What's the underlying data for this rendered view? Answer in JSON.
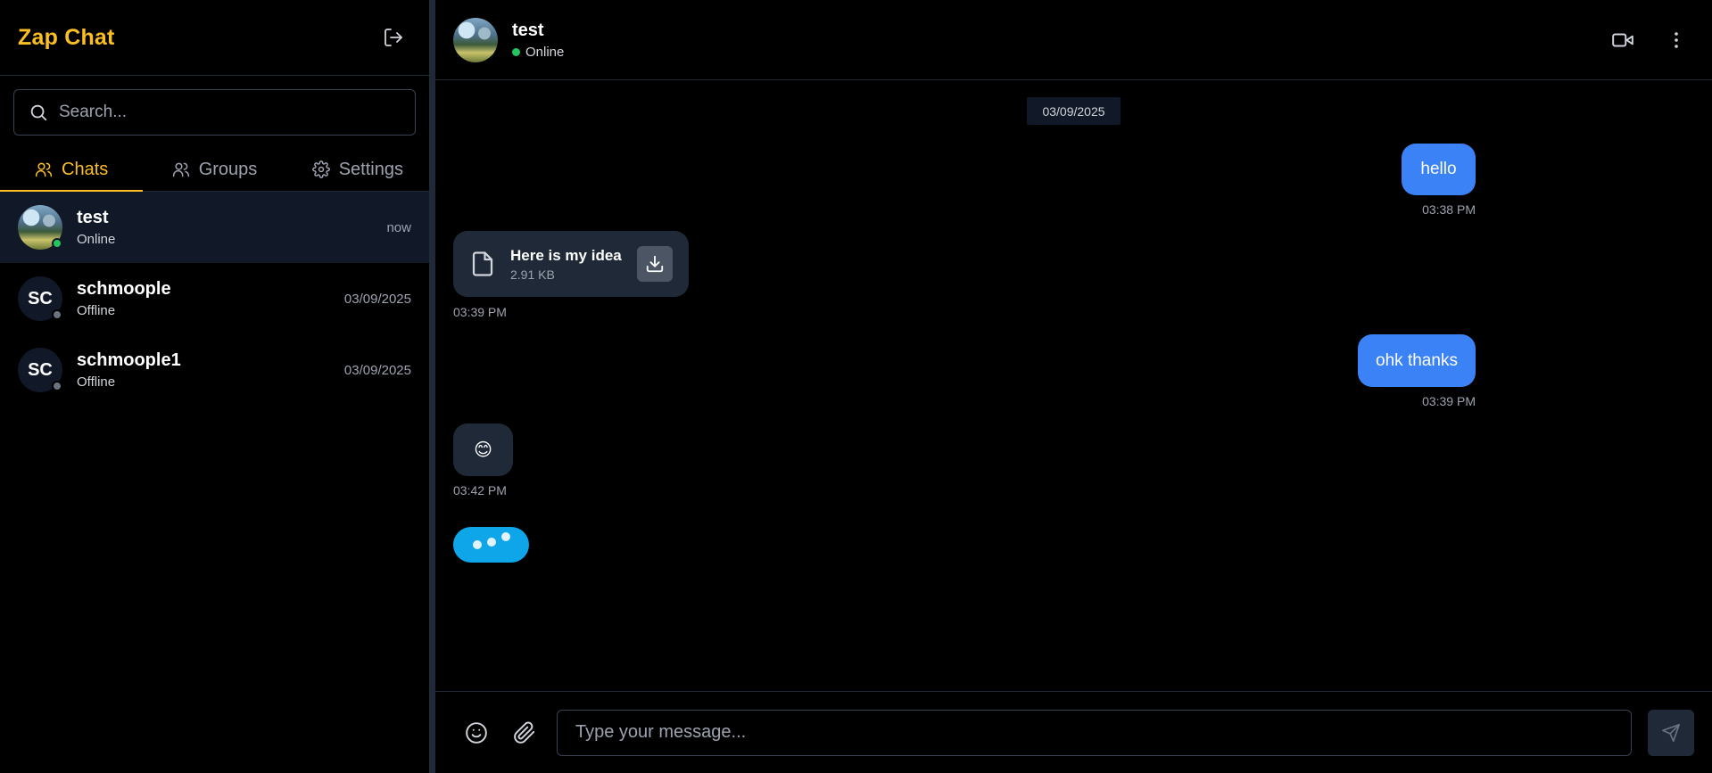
{
  "app": {
    "title": "Zap Chat"
  },
  "colors": {
    "brand": "#fbbf24",
    "outgoing_bubble": "#3b82f6",
    "incoming_bubble": "#1f2937",
    "typing_bubble": "#0ea5e9",
    "online": "#22c55e",
    "offline": "#6b7280"
  },
  "sidebar": {
    "logout_icon": "logout-icon",
    "search": {
      "placeholder": "Search...",
      "value": ""
    },
    "tabs": [
      {
        "label": "Chats",
        "icon": "users-icon",
        "active": true
      },
      {
        "label": "Groups",
        "icon": "users-icon",
        "active": false
      },
      {
        "label": "Settings",
        "icon": "gear-icon",
        "active": false
      }
    ],
    "chats": [
      {
        "name": "test",
        "status": "Online",
        "time": "now",
        "initials": "",
        "selected": true
      },
      {
        "name": "schmoople",
        "status": "Offline",
        "time": "03/09/2025",
        "initials": "SC",
        "selected": false
      },
      {
        "name": "schmoople1",
        "status": "Offline",
        "time": "03/09/2025",
        "initials": "SC",
        "selected": false
      }
    ]
  },
  "conversation": {
    "contact_name": "test",
    "contact_status": "Online",
    "header_icons": [
      "video-icon",
      "more-vertical-icon"
    ],
    "date_divider": "03/09/2025",
    "messages": [
      {
        "direction": "out",
        "type": "text",
        "text": "hello",
        "time": "03:38 PM"
      },
      {
        "direction": "in",
        "type": "file",
        "file_name": "Here is my idea",
        "file_size": "2.91 KB",
        "time": "03:39 PM"
      },
      {
        "direction": "out",
        "type": "text",
        "text": "ohk thanks",
        "time": "03:39 PM"
      },
      {
        "direction": "in",
        "type": "text",
        "text": "😊",
        "time": "03:42 PM"
      }
    ],
    "typing_indicator": true
  },
  "composer": {
    "placeholder": "Type your message...",
    "value": "",
    "icons": [
      "smile-icon",
      "paperclip-icon",
      "send-icon"
    ]
  }
}
